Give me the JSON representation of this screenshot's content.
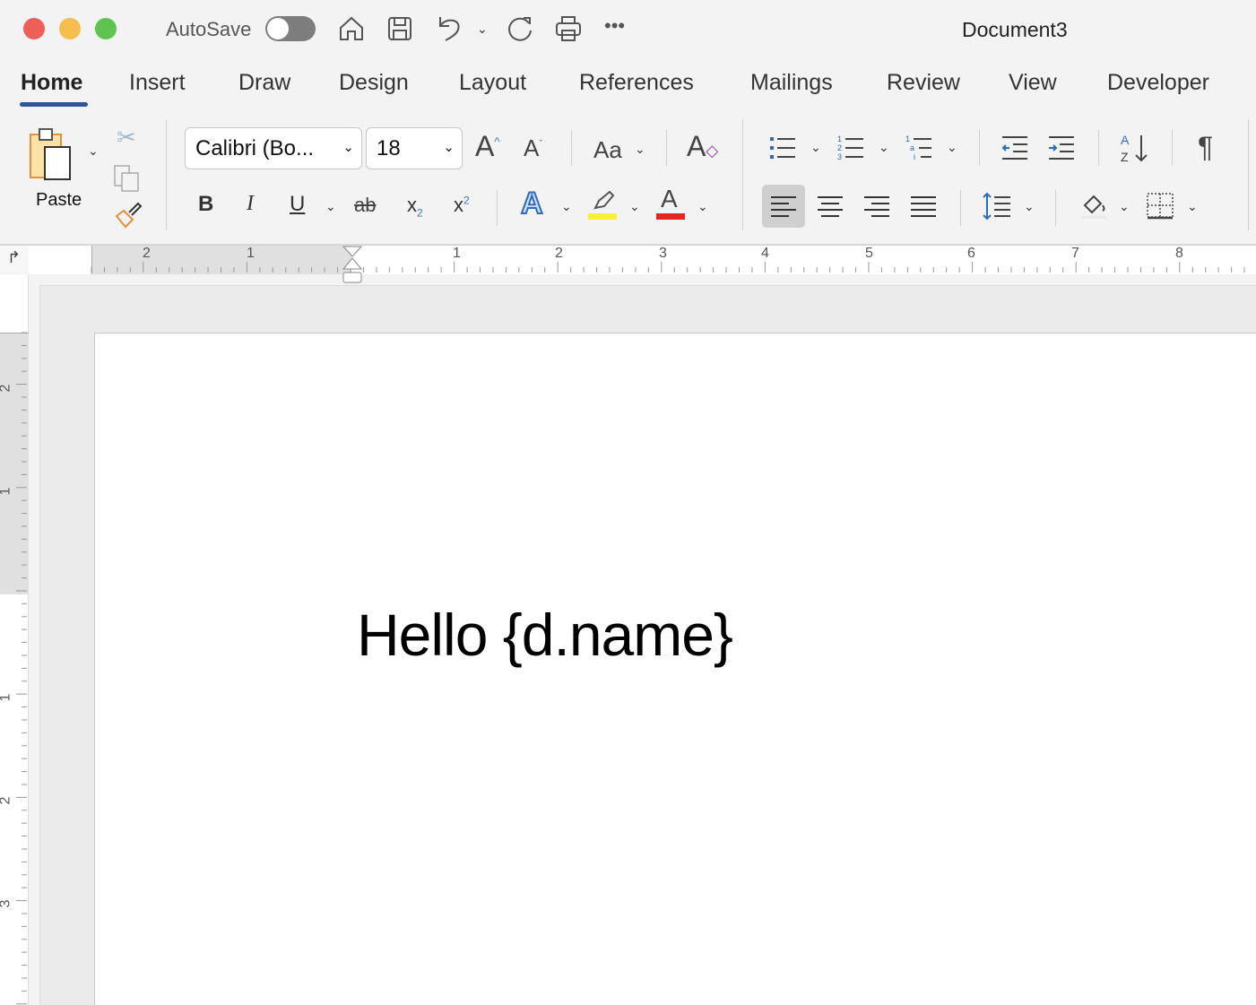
{
  "window": {
    "title": "Document3",
    "autosave_label": "AutoSave",
    "autosave_on": false
  },
  "tabs": [
    {
      "label": "Home",
      "active": true
    },
    {
      "label": "Insert"
    },
    {
      "label": "Draw"
    },
    {
      "label": "Design"
    },
    {
      "label": "Layout"
    },
    {
      "label": "References"
    },
    {
      "label": "Mailings"
    },
    {
      "label": "Review"
    },
    {
      "label": "View"
    },
    {
      "label": "Developer"
    }
  ],
  "ribbon": {
    "paste_label": "Paste",
    "font_name": "Calibri (Bo...",
    "font_size": "18",
    "case_label": "Aa",
    "highlight_color": "#f7f038",
    "font_color": "#e2281f"
  },
  "ruler": {
    "horizontal": [
      "2",
      "1",
      "1",
      "2",
      "3",
      "4",
      "5",
      "6",
      "7",
      "8"
    ],
    "vertical": [
      "2",
      "1",
      "1",
      "2",
      "3"
    ]
  },
  "document": {
    "text": "Hello {d.name}"
  },
  "colors": {
    "accent": "#2b579a",
    "close": "#ee5f57",
    "minimize": "#f6bd4f",
    "maximize": "#5fc44f"
  }
}
